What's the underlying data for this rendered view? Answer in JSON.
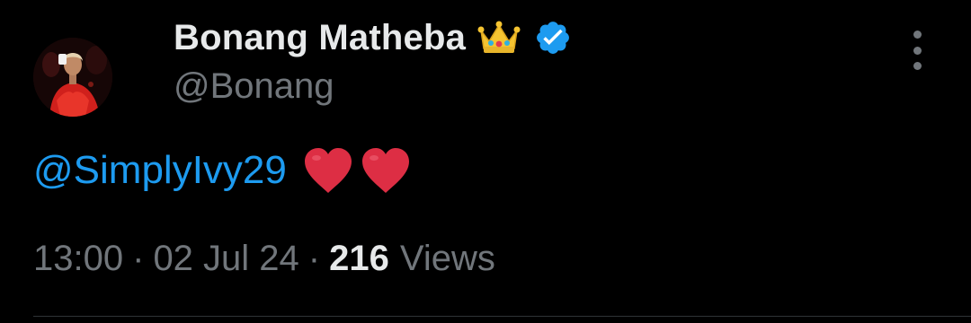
{
  "author": {
    "display_name": "Bonang Matheba",
    "handle": "@Bonang",
    "name_emoji": "crown-emoji",
    "verified": true,
    "avatar_icon": "avatar"
  },
  "tweet": {
    "mention": "@SimplyIvy29",
    "emojis": [
      "red-heart-emoji",
      "red-heart-emoji"
    ]
  },
  "meta": {
    "time": "13:00",
    "separator": "·",
    "date": "02 Jul 24",
    "views_count": "216",
    "views_label": "Views"
  },
  "colors": {
    "background": "#000000",
    "primary_text": "#e7e9ea",
    "secondary_text": "#71767b",
    "link": "#1d9bf0",
    "verified": "#1d9bf0",
    "divider": "#2f3336"
  },
  "icons": {
    "more": "more-vertical-icon",
    "verified": "verified-badge-icon"
  }
}
